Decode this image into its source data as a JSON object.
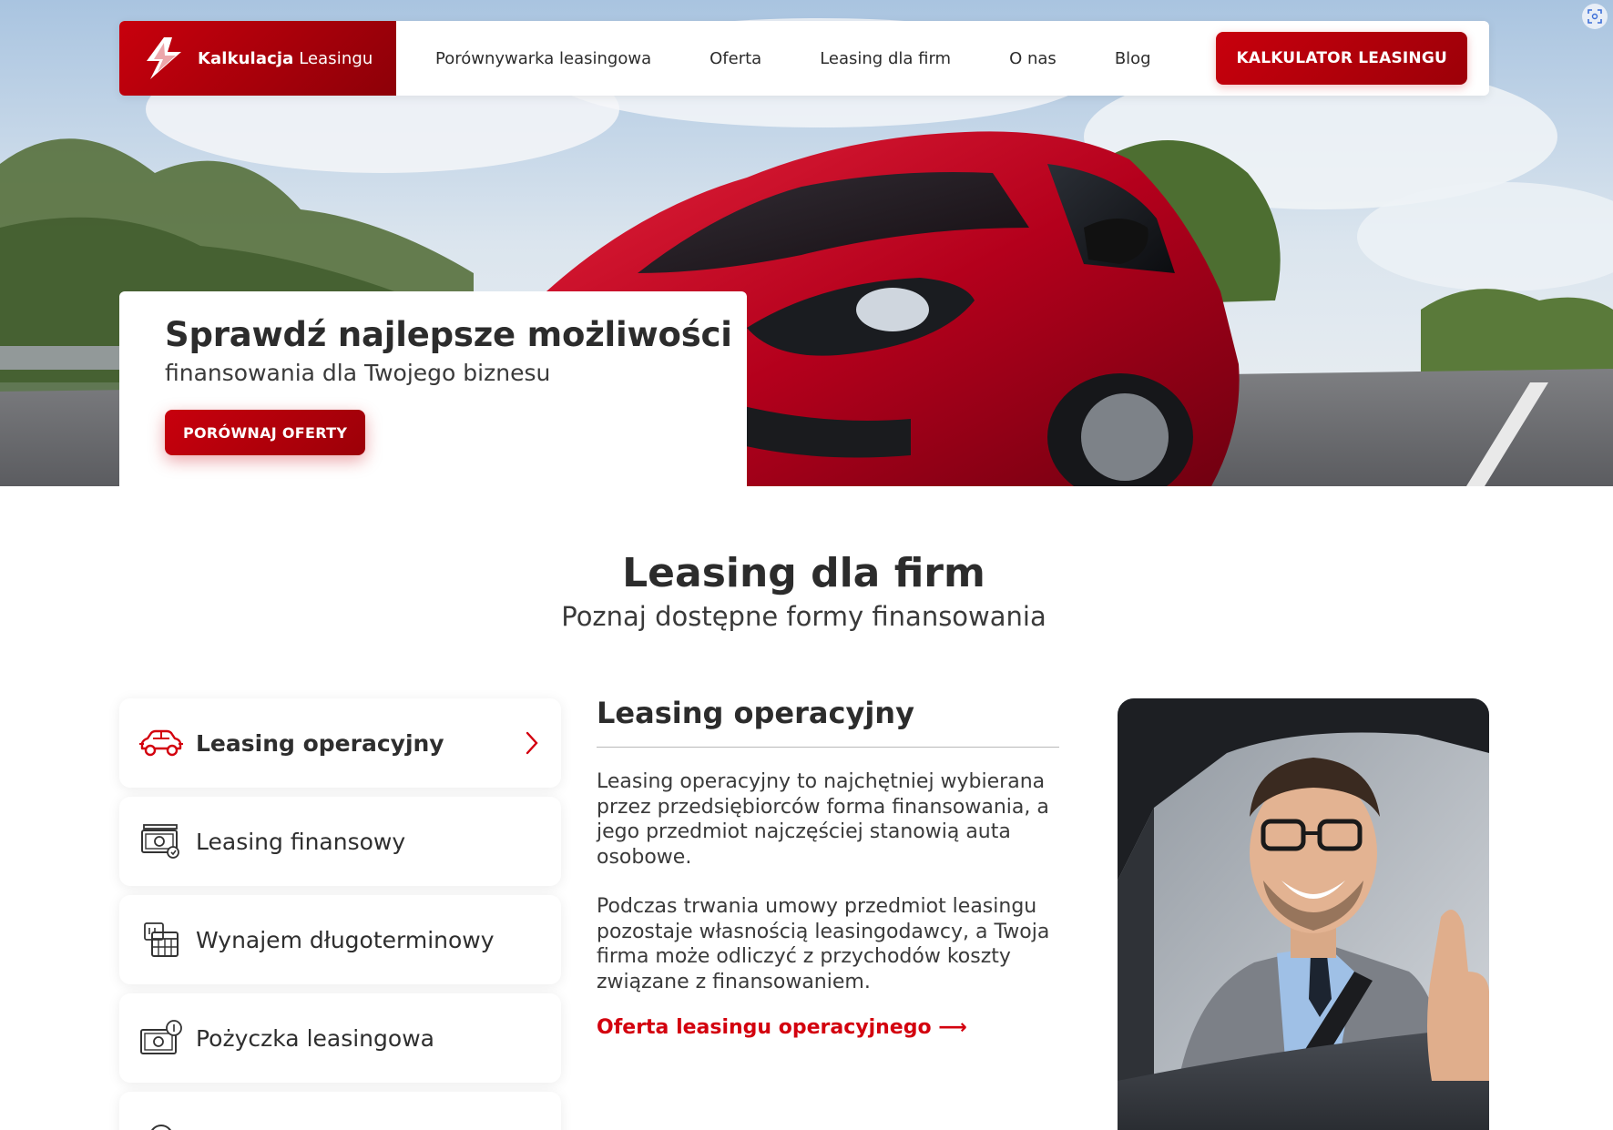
{
  "brand": {
    "name_bold": "Kalkulacja",
    "name_regular": "Leasingu",
    "accent_color": "#c8000d"
  },
  "nav": {
    "links": [
      "Porównywarka leasingowa",
      "Oferta",
      "Leasing dla firm",
      "O nas",
      "Blog"
    ],
    "cta_label": "KALKULATOR LEASINGU"
  },
  "hero": {
    "title": "Sprawdź najlepsze możliwości",
    "subtitle": "finansowania dla Twojego biznesu",
    "button_label": "PORÓWNAJ OFERTY",
    "image": "red-car-on-road-photo"
  },
  "section": {
    "title": "Leasing dla firm",
    "subtitle": "Poznaj dostępne formy finansowania"
  },
  "menu": {
    "items": [
      {
        "label": "Leasing operacyjny",
        "icon": "car-icon",
        "active": true
      },
      {
        "label": "Leasing finansowy",
        "icon": "money-bill-icon",
        "active": false
      },
      {
        "label": "Wynajem długoterminowy",
        "icon": "calendar-icon",
        "active": false
      },
      {
        "label": "Pożyczka leasingowa",
        "icon": "cash-coin-icon",
        "active": false
      }
    ]
  },
  "content": {
    "title": "Leasing operacyjny",
    "paragraph_1": "Leasing operacyjny to najchętniej wybierana przez przedsiębiorców forma finansowania, a jego przedmiot najczęściej stanowią auta osobowe.",
    "paragraph_2": "Podczas trwania umowy przedmiot leasingu pozostaje własnością leasingodawcy, a Twoja firma może odliczyć z przychodów koszty związane z finansowaniem.",
    "link_label": "Oferta leasingu operacyjnego",
    "link_arrow": "⟶"
  },
  "photo": {
    "image": "smiling-man-in-car-thumbs-up-photo"
  }
}
